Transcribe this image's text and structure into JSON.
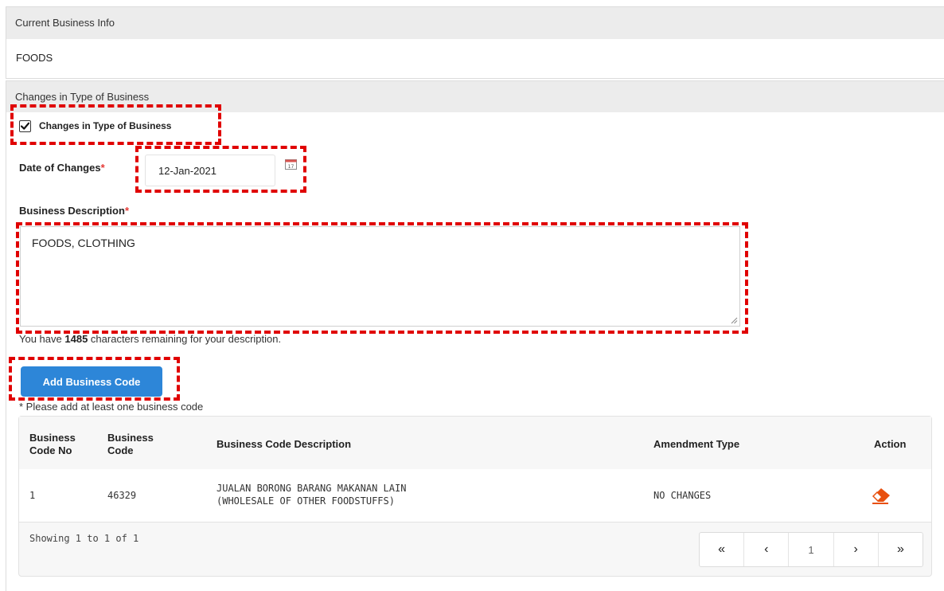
{
  "current_business": {
    "header": "Current Business Info",
    "value": "FOODS"
  },
  "changes": {
    "header": "Changes in Type of Business",
    "checkbox_label": "Changes in Type of Business",
    "checkbox_checked": true,
    "date_label": "Date of Changes",
    "required_mark": "*",
    "date_value": "12-Jan-2021",
    "description_label": "Business Description",
    "description_value": "FOODS, CLOTHING",
    "remaining_prefix": "You have",
    "remaining_count": "1485",
    "remaining_suffix": "characters remaining for your description.",
    "add_button": "Add Business Code",
    "hint": "* Please add at least one business code"
  },
  "table": {
    "columns": [
      "Business Code No",
      "Business Code",
      "Business Code Description",
      "Amendment Type",
      "Action"
    ],
    "col_no_lines": [
      "Business",
      "Code No"
    ],
    "col_code_lines": [
      "Business",
      "Code"
    ],
    "rows": [
      {
        "no": "1",
        "code": "46329",
        "description_line1": "JUALAN BORONG BARANG MAKANAN LAIN",
        "description_line2": "(WHOLESALE OF OTHER FOODSTUFFS)",
        "amendment": "NO CHANGES",
        "action_icon": "eraser-icon"
      }
    ],
    "showing": "Showing 1 to 1 of 1"
  },
  "pagination": {
    "first": "«",
    "prev": "‹",
    "page": "1",
    "next": "›",
    "last": "»"
  },
  "colors": {
    "accent_button": "#2d86d8",
    "highlight_box": "#e00000",
    "required": "#e53935",
    "eraser": "#e8500f"
  }
}
